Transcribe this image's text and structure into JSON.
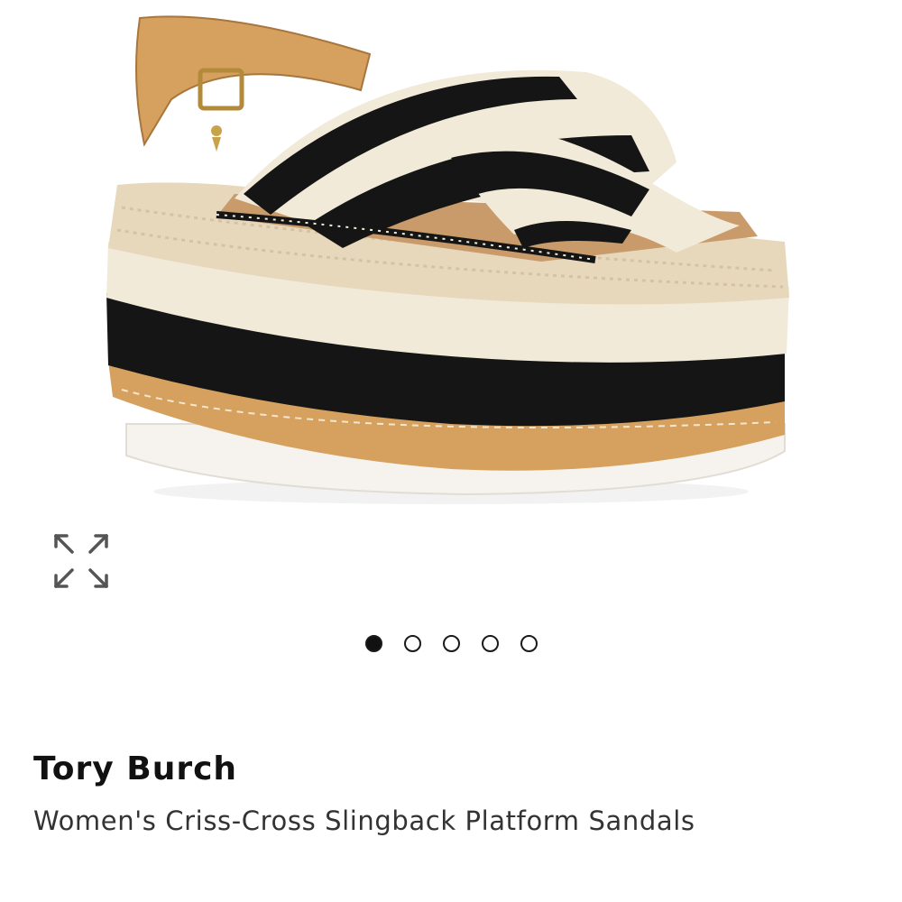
{
  "product": {
    "brand": "Tory Burch",
    "name": "Women's Criss-Cross Slingback Platform Sandals"
  },
  "gallery": {
    "image_alt": "Tory Burch Women's Criss-Cross Slingback Platform Sandals",
    "expand_icon": "expand-arrows-icon",
    "image_count": 5,
    "current_index": 1
  },
  "colors": {
    "black": "#111111",
    "cream": "#f1ead8",
    "tan": "#d6a15e",
    "jute": "#e7d8bc"
  }
}
